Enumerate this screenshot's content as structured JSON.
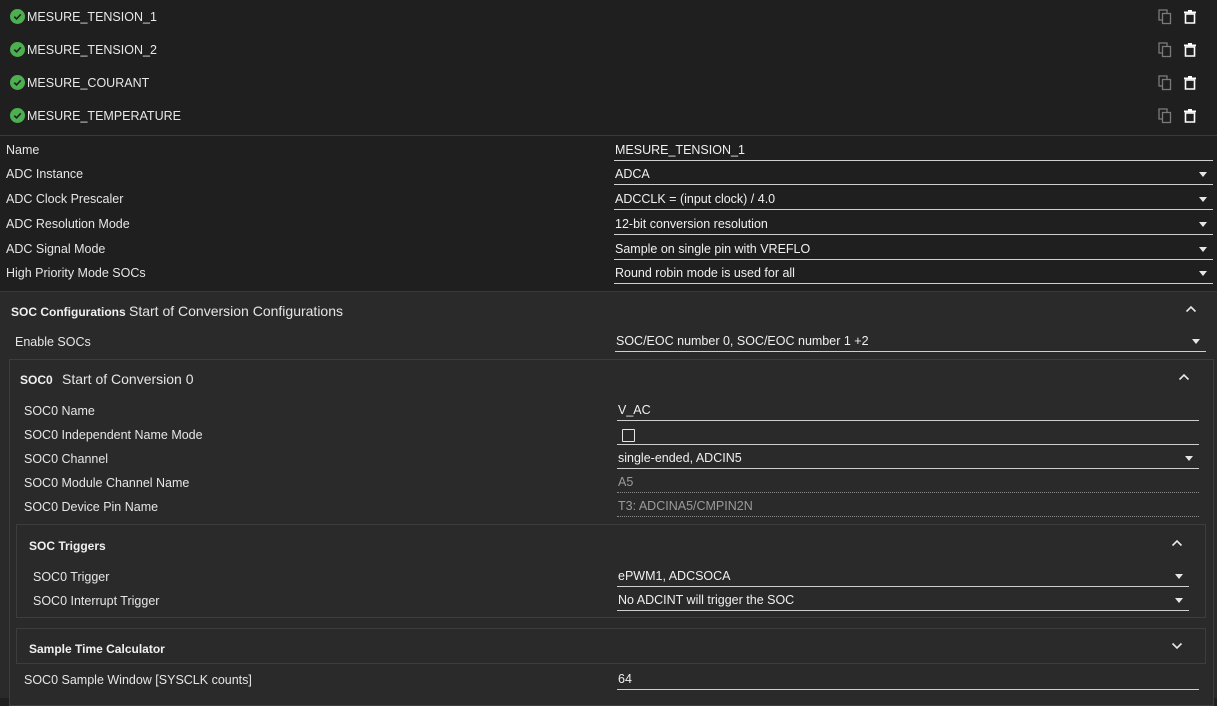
{
  "list": [
    {
      "label": "MESURE_TENSION_1"
    },
    {
      "label": "MESURE_TENSION_2"
    },
    {
      "label": "MESURE_COURANT"
    },
    {
      "label": "MESURE_TEMPERATURE"
    }
  ],
  "props": [
    {
      "label": "Name",
      "value": "MESURE_TENSION_1",
      "dropdown": false
    },
    {
      "label": "ADC Instance",
      "value": "ADCA",
      "dropdown": true
    },
    {
      "label": "ADC Clock Prescaler",
      "value": "ADCCLK = (input clock) / 4.0",
      "dropdown": true
    },
    {
      "label": "ADC Resolution Mode",
      "value": "12-bit conversion resolution",
      "dropdown": true
    },
    {
      "label": "ADC Signal Mode",
      "value": "Sample on single pin with VREFLO",
      "dropdown": true
    },
    {
      "label": "High Priority Mode SOCs",
      "value": "Round robin mode is used for all",
      "dropdown": true
    }
  ],
  "soc_config": {
    "title": "SOC Configurations",
    "description": "Start of Conversion Configurations",
    "enable_label": "Enable SOCs",
    "enable_value": "SOC/EOC number 0, SOC/EOC number 1 +2"
  },
  "soc0": {
    "title": "SOC0",
    "description": "Start of Conversion 0",
    "name_label": "SOC0 Name",
    "name_value": "V_AC",
    "independent_label": "SOC0 Independent Name Mode",
    "independent_checked": false,
    "channel_label": "SOC0 Channel",
    "channel_value": "single-ended, ADCIN5",
    "module_label": "SOC0 Module Channel Name",
    "module_value": "A5",
    "pin_label": "SOC0 Device Pin Name",
    "pin_value": "T3: ADCINA5/CMPIN2N"
  },
  "triggers": {
    "title": "SOC Triggers",
    "trigger_label": "SOC0 Trigger",
    "trigger_value": "ePWM1, ADCSOCA",
    "interrupt_label": "SOC0 Interrupt Trigger",
    "interrupt_value": "No ADCINT will trigger the SOC"
  },
  "sample_calc": {
    "title": "Sample Time Calculator"
  },
  "sample_window": {
    "label": "SOC0 Sample Window [SYSCLK counts]",
    "value": "64"
  },
  "colors": {
    "check": "#4caf50",
    "background": "#1f1f1f",
    "section": "#2a2a2a"
  }
}
